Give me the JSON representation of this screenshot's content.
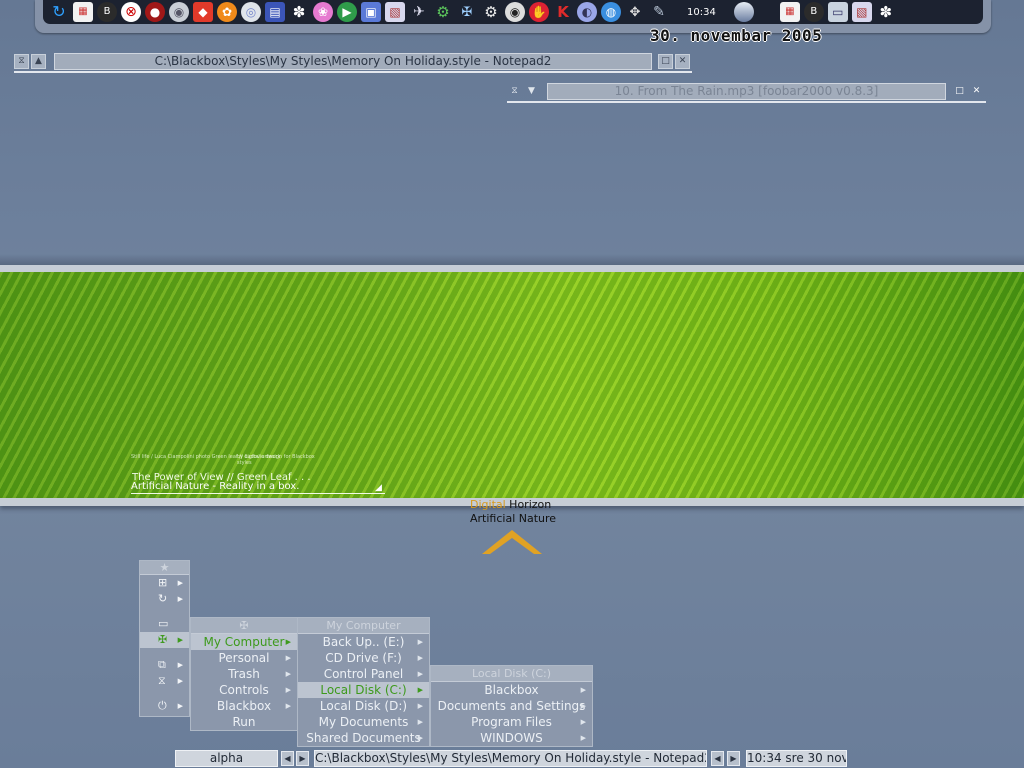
{
  "dock": {
    "clock": "10:34",
    "icons": [
      "refresh-icon",
      "gift-icon",
      "blackbox-b-icon",
      "lifesaver-icon",
      "red-circle-icon",
      "drive-icon",
      "red-diamond-icon",
      "fruityloops-icon",
      "cd-icon",
      "notepad-icon",
      "flower-icon",
      "paint-icon",
      "media-player-icon",
      "monitor-icon",
      "screenshot-icon",
      "satellite-icon",
      "gear-icon",
      "tools-icon",
      "settings-gear-icon",
      "eye-icon",
      "hand-icon",
      "k-icon",
      "disc-icon",
      "globe-icon",
      "network-icon",
      "wrench-icon"
    ],
    "right_icons": [
      "gift-icon",
      "blackbox-b-icon",
      "windows-icon",
      "screenshot-icon",
      "flower-icon"
    ],
    "date_banner": "30. novembar 2005"
  },
  "windows": [
    {
      "title": "C:\\Blackbox\\Styles\\My Styles\\Memory On Holiday.style - Notepad2",
      "active": true
    },
    {
      "title": "10. From The Rain.mp3     [foobar2000 v0.8.3]",
      "active": false
    }
  ],
  "banner": {
    "fine_left": "Still life / Luca Ciampolini photo Green leaf // digital artwork",
    "fine_right": "by Ludovic design for Blackbox styles",
    "line1": "The Power of View  //  Green Leaf . . .",
    "line2": "Artificial Nature - Reality in a box.",
    "logo_word1": "Digital",
    "logo_word2": " Horizon",
    "logo_sub": "Artificial Nature"
  },
  "root_menu": {
    "items": [
      {
        "icon": "★",
        "name": "favorites-icon"
      },
      {
        "icon": "⊞",
        "name": "windows-grid-icon"
      },
      {
        "icon": "↻",
        "name": "refresh-icon"
      },
      {
        "icon": "",
        "name": "spacer"
      },
      {
        "icon": "▭",
        "name": "folder-icon"
      },
      {
        "icon": "✠",
        "name": "tools-icon"
      },
      {
        "icon": "",
        "name": "spacer"
      },
      {
        "icon": "⧉",
        "name": "windows-stack-icon"
      },
      {
        "icon": "⧖",
        "name": "hourglass-icon"
      },
      {
        "icon": "",
        "name": "spacer"
      },
      {
        "icon": "⏻",
        "name": "power-icon"
      }
    ]
  },
  "tools_menu": {
    "header_icon": "✠",
    "items": [
      "My Computer",
      "Personal",
      "Trash",
      "Controls",
      "Blackbox",
      "Run"
    ]
  },
  "computer_menu": {
    "header": "My Computer",
    "items": [
      "Back Up.. (E:)",
      "CD Drive (F:)",
      "Control Panel",
      "Local Disk (C:)",
      "Local Disk (D:)",
      "My Documents",
      "Shared Documents"
    ]
  },
  "disk_menu": {
    "header": "Local Disk (C:)",
    "items": [
      "Blackbox",
      "Documents and Settings",
      "Program Files",
      "WINDOWS"
    ]
  },
  "taskbar": {
    "workspace": "alpha",
    "current_window": "C:\\Blackbox\\Styles\\My Styles\\Memory On Holiday.style - Notepad2",
    "clock": "10:34 sre 30 nov"
  },
  "colors": {
    "accent_green": "#3d9a1c",
    "logo_orange": "#d89a1c",
    "menu_bg": "#8b97ab",
    "dock_bg": "#1c2230"
  }
}
